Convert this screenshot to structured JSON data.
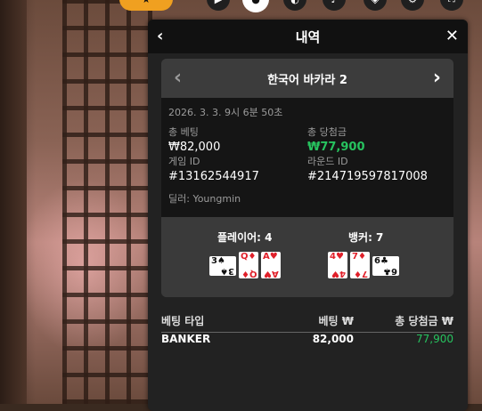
{
  "header": {
    "title": "내역"
  },
  "game_nav": {
    "name": "한국어 바카라 2"
  },
  "detail": {
    "date": "2026. 3. 3. 9시 6분 50초",
    "total_bet_label": "총 베팅",
    "total_bet_value": "₩82,000",
    "total_win_label": "총 당첨금",
    "total_win_value": "₩77,900",
    "game_id_label": "게임 ID",
    "game_id_value": "#13162544917",
    "round_id_label": "라운드 ID",
    "round_id_value": "#214719597817008",
    "dealer": "딜러: Youngmin"
  },
  "result": {
    "player_label": "플레이어: 4",
    "banker_label": "뱅커: 7",
    "player_cards": [
      {
        "rank": "3",
        "suit": "♠",
        "color": "#111111",
        "sideways": true
      },
      {
        "rank": "Q",
        "suit": "♦",
        "color": "#e0202a",
        "sideways": false
      },
      {
        "rank": "A",
        "suit": "♥",
        "color": "#e0202a",
        "sideways": false
      }
    ],
    "banker_cards": [
      {
        "rank": "4",
        "suit": "♥",
        "color": "#e0202a",
        "sideways": false
      },
      {
        "rank": "7",
        "suit": "♦",
        "color": "#e0202a",
        "sideways": false
      },
      {
        "rank": "6",
        "suit": "♣",
        "color": "#111111",
        "sideways": true
      }
    ]
  },
  "table": {
    "headers": [
      "베팅 타입",
      "베팅 ₩",
      "총 당첨금 ₩"
    ],
    "rows": [
      {
        "type": "BANKER",
        "bet": "82,000",
        "win": "77,900"
      }
    ]
  },
  "colors": {
    "win_green": "#27c35f",
    "panel_bg": "#222222",
    "header_bg": "#111111"
  },
  "icons": {
    "back": "chevron-left-icon",
    "close": "close-icon",
    "prev": "chevron-left-icon",
    "next": "chevron-right-icon"
  }
}
